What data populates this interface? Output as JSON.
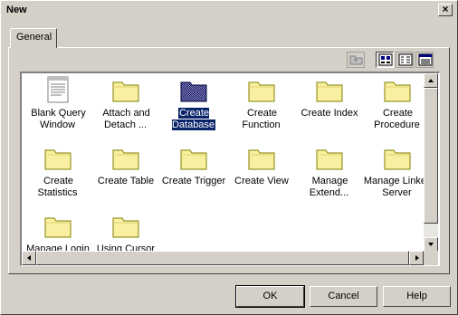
{
  "window": {
    "title": "New",
    "close_glyph": "×"
  },
  "tabs": [
    {
      "label": "General"
    }
  ],
  "toolbar": {
    "icons": [
      "up-folder-icon",
      "large-icons-view-icon",
      "small-icons-view-icon",
      "details-view-icon"
    ]
  },
  "items": [
    {
      "label": "Blank Query Window",
      "icon": "document-icon",
      "selected": false
    },
    {
      "label": "Attach and Detach ...",
      "icon": "folder-icon",
      "selected": false
    },
    {
      "label": "Create Database",
      "icon": "folder-icon",
      "selected": true
    },
    {
      "label": "Create Function",
      "icon": "folder-icon",
      "selected": false
    },
    {
      "label": "Create Index",
      "icon": "folder-icon",
      "selected": false
    },
    {
      "label": "Create Procedure",
      "icon": "folder-icon",
      "selected": false
    },
    {
      "label": "Create Statistics",
      "icon": "folder-icon",
      "selected": false
    },
    {
      "label": "Create Table",
      "icon": "folder-icon",
      "selected": false
    },
    {
      "label": "Create Trigger",
      "icon": "folder-icon",
      "selected": false
    },
    {
      "label": "Create View",
      "icon": "folder-icon",
      "selected": false
    },
    {
      "label": "Manage Extend...",
      "icon": "folder-icon",
      "selected": false
    },
    {
      "label": "Manage Linked Server",
      "icon": "folder-icon",
      "selected": false
    },
    {
      "label": "Manage Login",
      "icon": "folder-icon",
      "selected": false
    },
    {
      "label": "Using Cursor",
      "icon": "folder-icon",
      "selected": false
    }
  ],
  "buttons": {
    "ok": "OK",
    "cancel": "Cancel",
    "help": "Help"
  },
  "colors": {
    "face": "#d4d0c8",
    "selection": "#0a246a",
    "folder": "#f8f0a0"
  }
}
